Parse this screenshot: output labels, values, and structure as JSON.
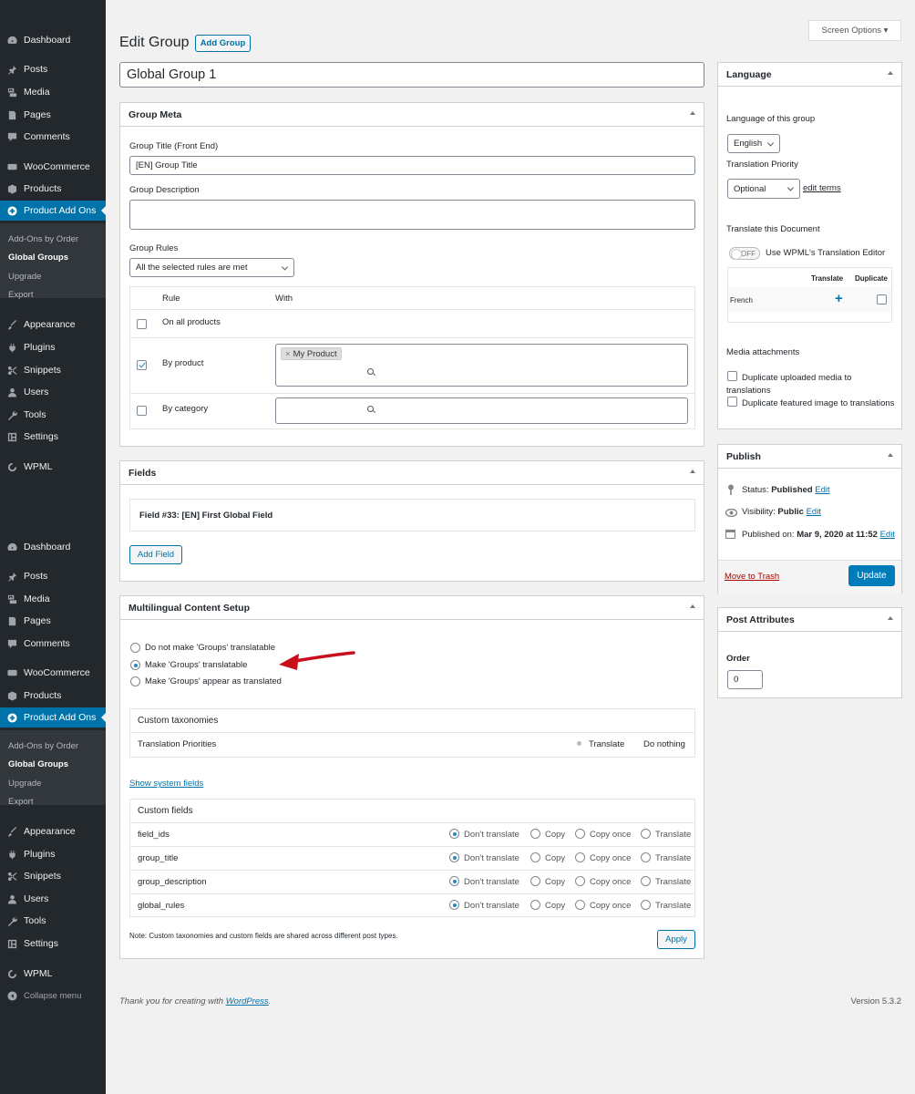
{
  "sidebar": {
    "top_menu": [
      {
        "label": "Dashboard",
        "icon": "dashboard-icon"
      },
      {
        "label": "Posts",
        "icon": "pin-icon"
      },
      {
        "label": "Media",
        "icon": "media-icon"
      },
      {
        "label": "Pages",
        "icon": "page-icon"
      },
      {
        "label": "Comments",
        "icon": "comment-icon"
      },
      {
        "label": "WooCommerce",
        "icon": "woocommerce-icon"
      },
      {
        "label": "Products",
        "icon": "archive-icon"
      },
      {
        "label": "Product Add Ons",
        "icon": "plus-circle-icon"
      },
      {
        "label": "Appearance",
        "icon": "brush-icon"
      },
      {
        "label": "Plugins",
        "icon": "plugin-icon"
      },
      {
        "label": "Snippets",
        "icon": "scissors-icon"
      },
      {
        "label": "Users",
        "icon": "user-icon"
      },
      {
        "label": "Tools",
        "icon": "wrench-icon"
      },
      {
        "label": "Settings",
        "icon": "settings-icon"
      },
      {
        "label": "WPML",
        "icon": "wpml-icon"
      }
    ],
    "submenu": [
      "Add-Ons by Order",
      "Global Groups",
      "Upgrade",
      "Export"
    ],
    "bottom_menu": [
      {
        "label": "Dashboard",
        "icon": "dashboard-icon"
      },
      {
        "label": "Posts",
        "icon": "pin-icon"
      },
      {
        "label": "Media",
        "icon": "media-icon"
      },
      {
        "label": "Pages",
        "icon": "page-icon"
      },
      {
        "label": "Comments",
        "icon": "comment-icon"
      },
      {
        "label": "WooCommerce",
        "icon": "woocommerce-icon"
      },
      {
        "label": "Products",
        "icon": "archive-icon"
      },
      {
        "label": "Product Add Ons",
        "icon": "plus-circle-icon"
      },
      {
        "label": "Appearance",
        "icon": "brush-icon"
      },
      {
        "label": "Plugins",
        "icon": "plugin-icon"
      },
      {
        "label": "Snippets",
        "icon": "scissors-icon"
      },
      {
        "label": "Users",
        "icon": "user-icon"
      },
      {
        "label": "Tools",
        "icon": "wrench-icon"
      },
      {
        "label": "Settings",
        "icon": "settings-icon"
      },
      {
        "label": "WPML",
        "icon": "wpml-icon"
      }
    ],
    "collapse_label": "Collapse menu"
  },
  "header": {
    "title": "Edit Group",
    "add_button": "Add Group",
    "screen_options": "Screen Options ▾"
  },
  "post_title": "Global Group 1",
  "group_meta": {
    "heading": "Group Meta",
    "title_label": "Group Title (Front End)",
    "title_value": "[EN] Group Title",
    "desc_label": "Group Description",
    "rules_label": "Group Rules",
    "rules_value": "All the selected rules are met",
    "col_rule": "Rule",
    "col_with": "With",
    "rows": [
      {
        "label": "On all products"
      },
      {
        "label": "By product",
        "tag": "My Product"
      },
      {
        "label": "By category"
      }
    ]
  },
  "fields": {
    "heading": "Fields",
    "field_title": "Field #33: [EN] First Global Field",
    "add_button": "Add Field"
  },
  "multilingual": {
    "heading": "Multilingual Content Setup",
    "options": [
      "Do not make 'Groups' translatable",
      "Make 'Groups' translatable",
      "Make 'Groups' appear as translated"
    ],
    "taxonomies_heading": "Custom taxonomies",
    "taxonomy_row": {
      "name": "Translation Priorities",
      "opt1": "Translate",
      "opt2": "Do nothing"
    },
    "show_system_fields": "Show system fields",
    "fields_heading": "Custom fields",
    "field_options": [
      "Don't translate",
      "Copy",
      "Copy once",
      "Translate"
    ],
    "field_rows": [
      "field_ids",
      "group_title",
      "group_description",
      "global_rules"
    ],
    "note": "Note: Custom taxonomies and custom fields are shared across different post types.",
    "apply": "Apply"
  },
  "language": {
    "heading": "Language",
    "lang_label": "Language of this group",
    "lang_value": "English",
    "priority_label": "Translation Priority",
    "priority_value": "Optional",
    "edit_terms": "edit terms",
    "translate_doc": "Translate this Document",
    "toggle_label": "OFF",
    "editor_label": "Use WPML's Translation Editor",
    "col_translate": "Translate",
    "col_duplicate": "Duplicate",
    "row_lang": "French",
    "media_heading": "Media attachments",
    "media_opt1": "Duplicate uploaded media to translations",
    "media_opt2": "Duplicate featured image to translations"
  },
  "publish": {
    "heading": "Publish",
    "status_label": "Status:",
    "status_value": "Published",
    "visibility_label": "Visibility:",
    "visibility_value": "Public",
    "published_label": "Published on:",
    "published_value": "Mar 9, 2020 at 11:52",
    "edit": "Edit",
    "trash": "Move to Trash",
    "update": "Update"
  },
  "attributes": {
    "heading": "Post Attributes",
    "order_label": "Order",
    "order_value": "0"
  },
  "footer": {
    "thanks_prefix": "Thank you for creating with ",
    "thanks_link": "WordPress",
    "thanks_suffix": ".",
    "version": "Version 5.3.2"
  },
  "colors": {
    "accent": "#0073aa",
    "sidebar": "#23282d",
    "trash": "#a00",
    "arrow": "#c8101c"
  }
}
